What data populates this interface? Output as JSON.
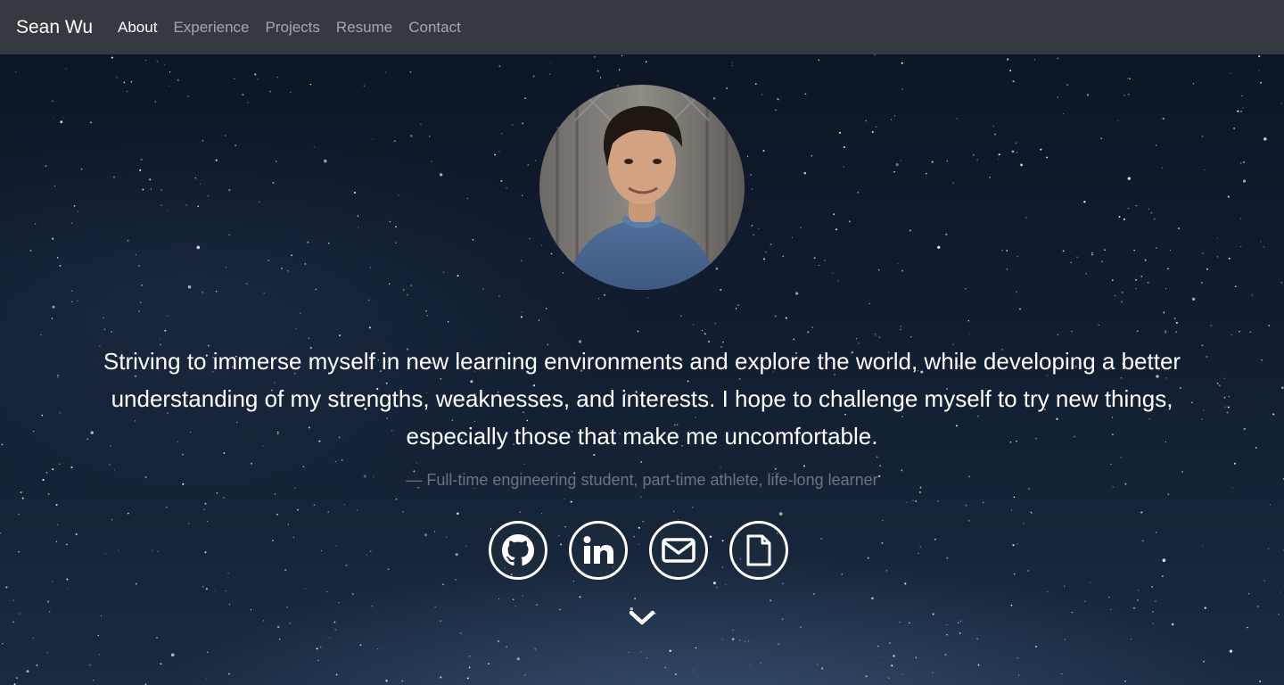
{
  "nav": {
    "brand": "Sean Wu",
    "links": [
      {
        "label": "About",
        "active": true
      },
      {
        "label": "Experience",
        "active": false
      },
      {
        "label": "Projects",
        "active": false
      },
      {
        "label": "Resume",
        "active": false
      },
      {
        "label": "Contact",
        "active": false
      }
    ]
  },
  "hero": {
    "quote_lines": [
      "Striving to immerse myself in new learning environments and explore the world, while developing a better",
      "understanding of my strengths, weaknesses, and interests. I hope to challenge myself to try new things,",
      "especially those that make me uncomfortable."
    ],
    "attribution": "— Full-time engineering student, part-time athlete, life-long learner",
    "socials": [
      {
        "icon": "github-icon"
      },
      {
        "icon": "linkedin-icon"
      },
      {
        "icon": "envelope-icon"
      },
      {
        "icon": "document-icon"
      }
    ],
    "scroll_icon": "chevron-down-icon"
  },
  "colors": {
    "navbar_bg": "#343a40",
    "nav_active": "#ffffff",
    "nav_inactive": "rgba(255,255,255,0.55)",
    "attribution_text": "#6c757d"
  }
}
